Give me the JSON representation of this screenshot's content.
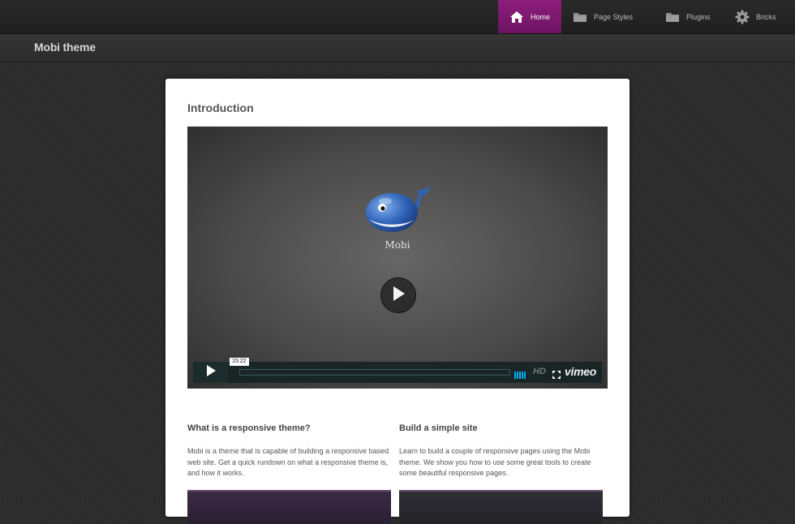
{
  "nav": {
    "items": [
      {
        "label": "Home",
        "icon": "home-icon",
        "active": true
      },
      {
        "label": "Page Styles",
        "icon": "folder-icon",
        "active": false
      },
      {
        "label": "Plugins",
        "icon": "folder-icon",
        "active": false
      },
      {
        "label": "Bricks",
        "icon": "gear-icon",
        "active": false
      }
    ],
    "active_color": "#8a1a7a"
  },
  "site": {
    "title": "Mobi theme"
  },
  "main": {
    "heading": "Introduction",
    "video": {
      "title": "Mobi",
      "timecode": "15:22",
      "hd_label": "HD",
      "brand": "vimeo",
      "accent_color": "#00adef"
    },
    "columns": [
      {
        "heading": "What is a responsive theme?",
        "text": "Mobi is a theme that is capable of building a responsive based web site. Get a quick rundown on what a responsive theme is, and how it works."
      },
      {
        "heading": "Build a simple site",
        "text": "Learn to build a couple of responsive pages using the Mobi theme. We show you how to use some great tools to create some beautiful responsive pages."
      }
    ]
  }
}
